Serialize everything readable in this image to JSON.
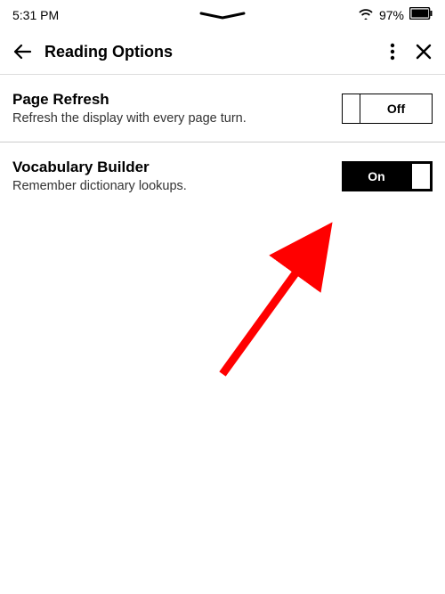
{
  "status": {
    "time": "5:31 PM",
    "battery_pct": "97%"
  },
  "header": {
    "title": "Reading Options"
  },
  "settings": {
    "page_refresh": {
      "title": "Page Refresh",
      "desc": "Refresh the display with every page turn.",
      "toggle_label": "Off"
    },
    "vocabulary_builder": {
      "title": "Vocabulary Builder",
      "desc": "Remember dictionary lookups.",
      "toggle_label": "On"
    }
  }
}
